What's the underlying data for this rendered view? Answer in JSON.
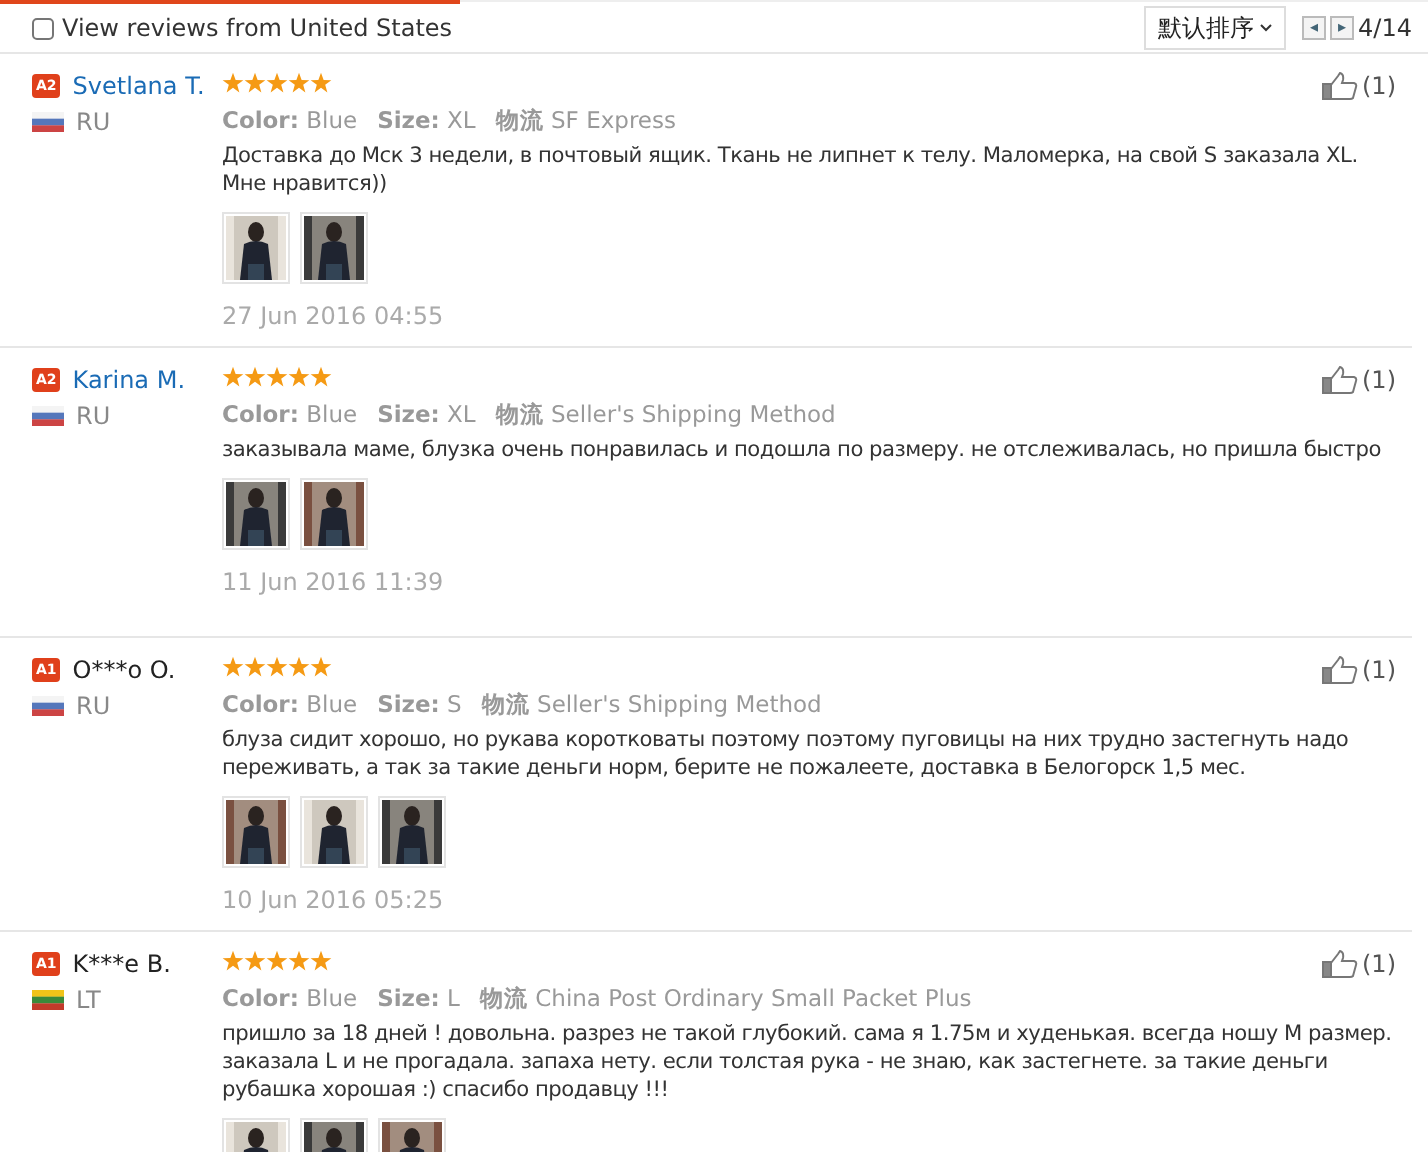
{
  "filter": {
    "label": "View reviews from United States",
    "checked": false
  },
  "sort": {
    "label": "默认排序"
  },
  "pager": {
    "prev": "◂",
    "next": "▸",
    "page": "4/14"
  },
  "reviews": [
    {
      "badge": "A2",
      "name": "Svetlana T.",
      "name_link": true,
      "flag": {
        "kind": "ru"
      },
      "country": "RU",
      "stars": 5,
      "color_label": "Color:",
      "color_value": "Blue",
      "size_label": "Size:",
      "size": "XL",
      "shipping_label": "物流",
      "shipping": "SF Express",
      "text": "Доставка до Мск 3 недели, в почтовый ящик. Ткань не липнет к телу. Маломерка, на свой S заказала XL. Мне нравится))",
      "photos": [
        {
          "kind": "picture"
        },
        {
          "kind": "picture"
        }
      ],
      "date": "27 Jun 2016 04:55",
      "likes": "(1)"
    },
    {
      "badge": "A2",
      "name": "Karina M.",
      "name_link": true,
      "flag": {
        "kind": "ru"
      },
      "country": "RU",
      "stars": 5,
      "color_label": "Color:",
      "color_value": "Blue",
      "size_label": "Size:",
      "size": "XL",
      "shipping_label": "物流",
      "shipping": "Seller's Shipping Method",
      "text": "заказывала маме, блузка очень понравилась и подошла по размеру. не отслеживалась, но пришла быстро",
      "photos": [
        {
          "kind": "picture"
        },
        {
          "kind": "picture"
        }
      ],
      "date": "11 Jun 2016 11:39",
      "likes": "(1)"
    },
    {
      "badge": "A1",
      "name": "O***o O.",
      "name_link": false,
      "flag": {
        "kind": "ru"
      },
      "country": "RU",
      "stars": 5,
      "color_label": "Color:",
      "color_value": "Blue",
      "size_label": "Size:",
      "size": "S",
      "shipping_label": "物流",
      "shipping": "Seller's Shipping Method",
      "text": "блуза сидит хорошо, но рукава коротковаты поэтому поэтому пуговицы на них трудно застегнуть надо переживать, а так за такие деньги норм, берите не пожалеете, доставка в Белогорск 1,5 мес.",
      "photos": [
        {
          "kind": "picture"
        },
        {
          "kind": "picture"
        },
        {
          "kind": "picture"
        }
      ],
      "date": "10 Jun 2016 05:25",
      "likes": "(1)"
    },
    {
      "badge": "A1",
      "name": "K***e B.",
      "name_link": false,
      "flag": {
        "kind": "lt"
      },
      "country": "LT",
      "stars": 5,
      "color_label": "Color:",
      "color_value": "Blue",
      "size_label": "Size:",
      "size": "L",
      "shipping_label": "物流",
      "shipping": "China Post Ordinary Small Packet Plus",
      "text": "пришло за 18 дней ! довольна. разрез не такой глубокий. сама я 1.75м и худенькая. всегда ношу M размер. заказала L и не прогадала. запаха нету. если толстая рука - не знаю, как застегнете. за такие деньги рубашка хорошая :) спасибо продавцу !!!",
      "photos": [
        {
          "kind": "picture"
        },
        {
          "kind": "picture"
        },
        {
          "kind": "picture"
        }
      ],
      "likes": "(1)"
    }
  ]
}
